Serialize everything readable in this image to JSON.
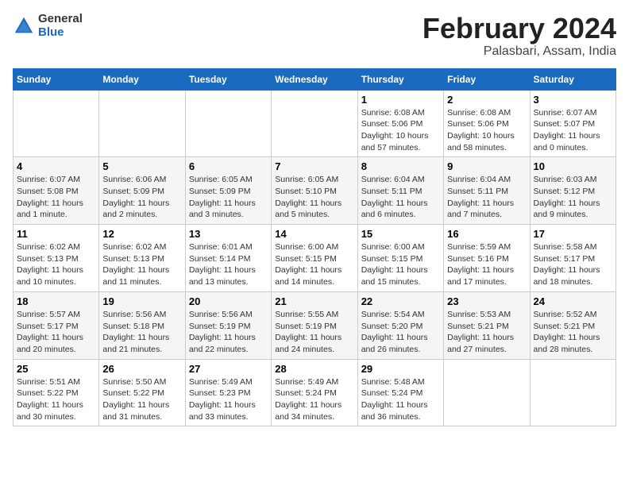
{
  "logo": {
    "general": "General",
    "blue": "Blue"
  },
  "title": {
    "month_year": "February 2024",
    "location": "Palasbari, Assam, India"
  },
  "days_of_week": [
    "Sunday",
    "Monday",
    "Tuesday",
    "Wednesday",
    "Thursday",
    "Friday",
    "Saturday"
  ],
  "weeks": [
    [
      {
        "day": "",
        "info": ""
      },
      {
        "day": "",
        "info": ""
      },
      {
        "day": "",
        "info": ""
      },
      {
        "day": "",
        "info": ""
      },
      {
        "day": "1",
        "info": "Sunrise: 6:08 AM\nSunset: 5:06 PM\nDaylight: 10 hours and 57 minutes."
      },
      {
        "day": "2",
        "info": "Sunrise: 6:08 AM\nSunset: 5:06 PM\nDaylight: 10 hours and 58 minutes."
      },
      {
        "day": "3",
        "info": "Sunrise: 6:07 AM\nSunset: 5:07 PM\nDaylight: 11 hours and 0 minutes."
      }
    ],
    [
      {
        "day": "4",
        "info": "Sunrise: 6:07 AM\nSunset: 5:08 PM\nDaylight: 11 hours and 1 minute."
      },
      {
        "day": "5",
        "info": "Sunrise: 6:06 AM\nSunset: 5:09 PM\nDaylight: 11 hours and 2 minutes."
      },
      {
        "day": "6",
        "info": "Sunrise: 6:05 AM\nSunset: 5:09 PM\nDaylight: 11 hours and 3 minutes."
      },
      {
        "day": "7",
        "info": "Sunrise: 6:05 AM\nSunset: 5:10 PM\nDaylight: 11 hours and 5 minutes."
      },
      {
        "day": "8",
        "info": "Sunrise: 6:04 AM\nSunset: 5:11 PM\nDaylight: 11 hours and 6 minutes."
      },
      {
        "day": "9",
        "info": "Sunrise: 6:04 AM\nSunset: 5:11 PM\nDaylight: 11 hours and 7 minutes."
      },
      {
        "day": "10",
        "info": "Sunrise: 6:03 AM\nSunset: 5:12 PM\nDaylight: 11 hours and 9 minutes."
      }
    ],
    [
      {
        "day": "11",
        "info": "Sunrise: 6:02 AM\nSunset: 5:13 PM\nDaylight: 11 hours and 10 minutes."
      },
      {
        "day": "12",
        "info": "Sunrise: 6:02 AM\nSunset: 5:13 PM\nDaylight: 11 hours and 11 minutes."
      },
      {
        "day": "13",
        "info": "Sunrise: 6:01 AM\nSunset: 5:14 PM\nDaylight: 11 hours and 13 minutes."
      },
      {
        "day": "14",
        "info": "Sunrise: 6:00 AM\nSunset: 5:15 PM\nDaylight: 11 hours and 14 minutes."
      },
      {
        "day": "15",
        "info": "Sunrise: 6:00 AM\nSunset: 5:15 PM\nDaylight: 11 hours and 15 minutes."
      },
      {
        "day": "16",
        "info": "Sunrise: 5:59 AM\nSunset: 5:16 PM\nDaylight: 11 hours and 17 minutes."
      },
      {
        "day": "17",
        "info": "Sunrise: 5:58 AM\nSunset: 5:17 PM\nDaylight: 11 hours and 18 minutes."
      }
    ],
    [
      {
        "day": "18",
        "info": "Sunrise: 5:57 AM\nSunset: 5:17 PM\nDaylight: 11 hours and 20 minutes."
      },
      {
        "day": "19",
        "info": "Sunrise: 5:56 AM\nSunset: 5:18 PM\nDaylight: 11 hours and 21 minutes."
      },
      {
        "day": "20",
        "info": "Sunrise: 5:56 AM\nSunset: 5:19 PM\nDaylight: 11 hours and 22 minutes."
      },
      {
        "day": "21",
        "info": "Sunrise: 5:55 AM\nSunset: 5:19 PM\nDaylight: 11 hours and 24 minutes."
      },
      {
        "day": "22",
        "info": "Sunrise: 5:54 AM\nSunset: 5:20 PM\nDaylight: 11 hours and 26 minutes."
      },
      {
        "day": "23",
        "info": "Sunrise: 5:53 AM\nSunset: 5:21 PM\nDaylight: 11 hours and 27 minutes."
      },
      {
        "day": "24",
        "info": "Sunrise: 5:52 AM\nSunset: 5:21 PM\nDaylight: 11 hours and 28 minutes."
      }
    ],
    [
      {
        "day": "25",
        "info": "Sunrise: 5:51 AM\nSunset: 5:22 PM\nDaylight: 11 hours and 30 minutes."
      },
      {
        "day": "26",
        "info": "Sunrise: 5:50 AM\nSunset: 5:22 PM\nDaylight: 11 hours and 31 minutes."
      },
      {
        "day": "27",
        "info": "Sunrise: 5:49 AM\nSunset: 5:23 PM\nDaylight: 11 hours and 33 minutes."
      },
      {
        "day": "28",
        "info": "Sunrise: 5:49 AM\nSunset: 5:24 PM\nDaylight: 11 hours and 34 minutes."
      },
      {
        "day": "29",
        "info": "Sunrise: 5:48 AM\nSunset: 5:24 PM\nDaylight: 11 hours and 36 minutes."
      },
      {
        "day": "",
        "info": ""
      },
      {
        "day": "",
        "info": ""
      }
    ]
  ]
}
